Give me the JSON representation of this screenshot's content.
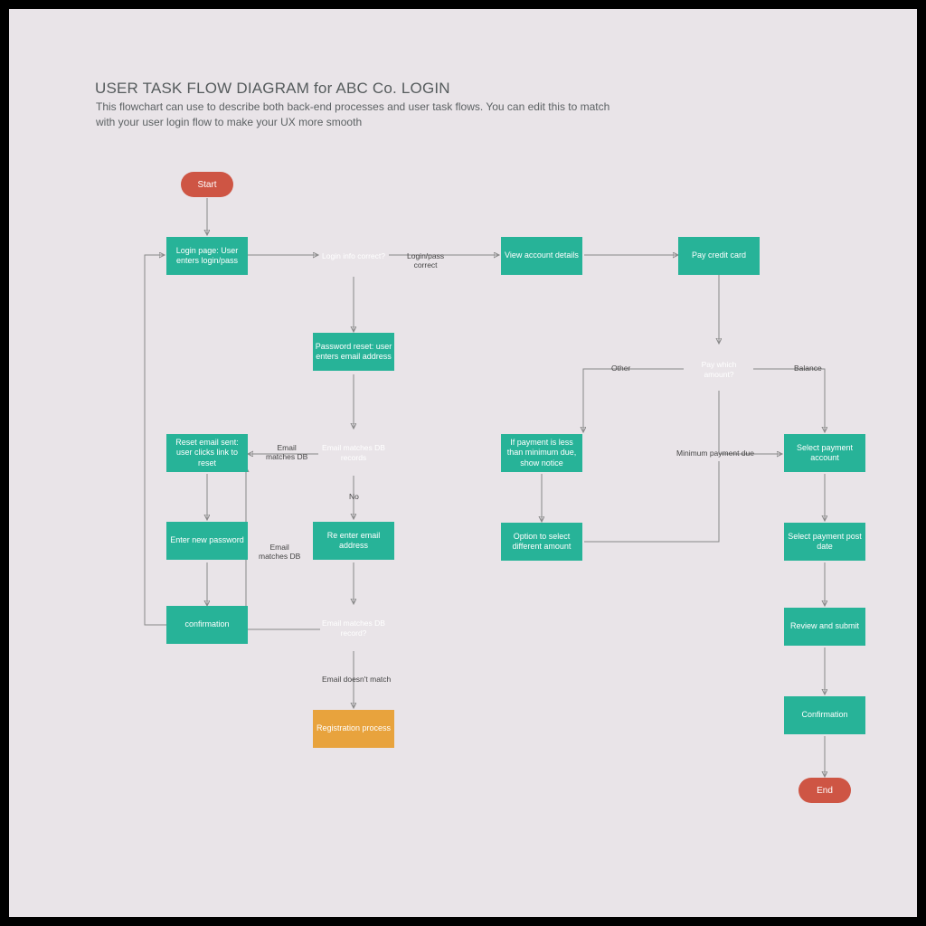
{
  "header": {
    "title": "USER TASK FLOW DIAGRAM for ABC Co. LOGIN",
    "subtitle": "This flowchart can use to describe both back-end processes and user task flows. You can edit this to match\nwith your user login flow to make your UX more smooth"
  },
  "nodes": {
    "start": "Start",
    "end": "End",
    "login_page": "Login page: User enters login/pass",
    "login_info": "Login info correct?",
    "view_account": "View account details",
    "pay_cc": "Pay credit card",
    "pwd_reset": "Password reset: user enters email address",
    "email_match": "Email matches DB records",
    "reset_sent": "Reset email sent: user clicks link to reset",
    "enter_new_pwd": "Enter new password",
    "confirmation1": "confirmation",
    "reenter": "Re enter email address",
    "email_match2": "Email matches DB record?",
    "registration": "Registration process",
    "pay_which": "Pay which amount?",
    "less_min": "If payment is less than minimum due, show notice",
    "opt_diff": "Option to select different amount",
    "sel_acct": "Select payment account",
    "sel_date": "Select payment post date",
    "review": "Review and submit",
    "confirmation2": "Confirmation"
  },
  "edge_labels": {
    "login_pass": "Login/pass\ncorrect",
    "email_db1": "Email\nmatches DB",
    "no": "No",
    "email_db2": "Email\nmatches DB",
    "email_no_match": "Email doesn't match",
    "other": "Other",
    "min_due": "Minimum payment due",
    "balance": "Balance"
  }
}
